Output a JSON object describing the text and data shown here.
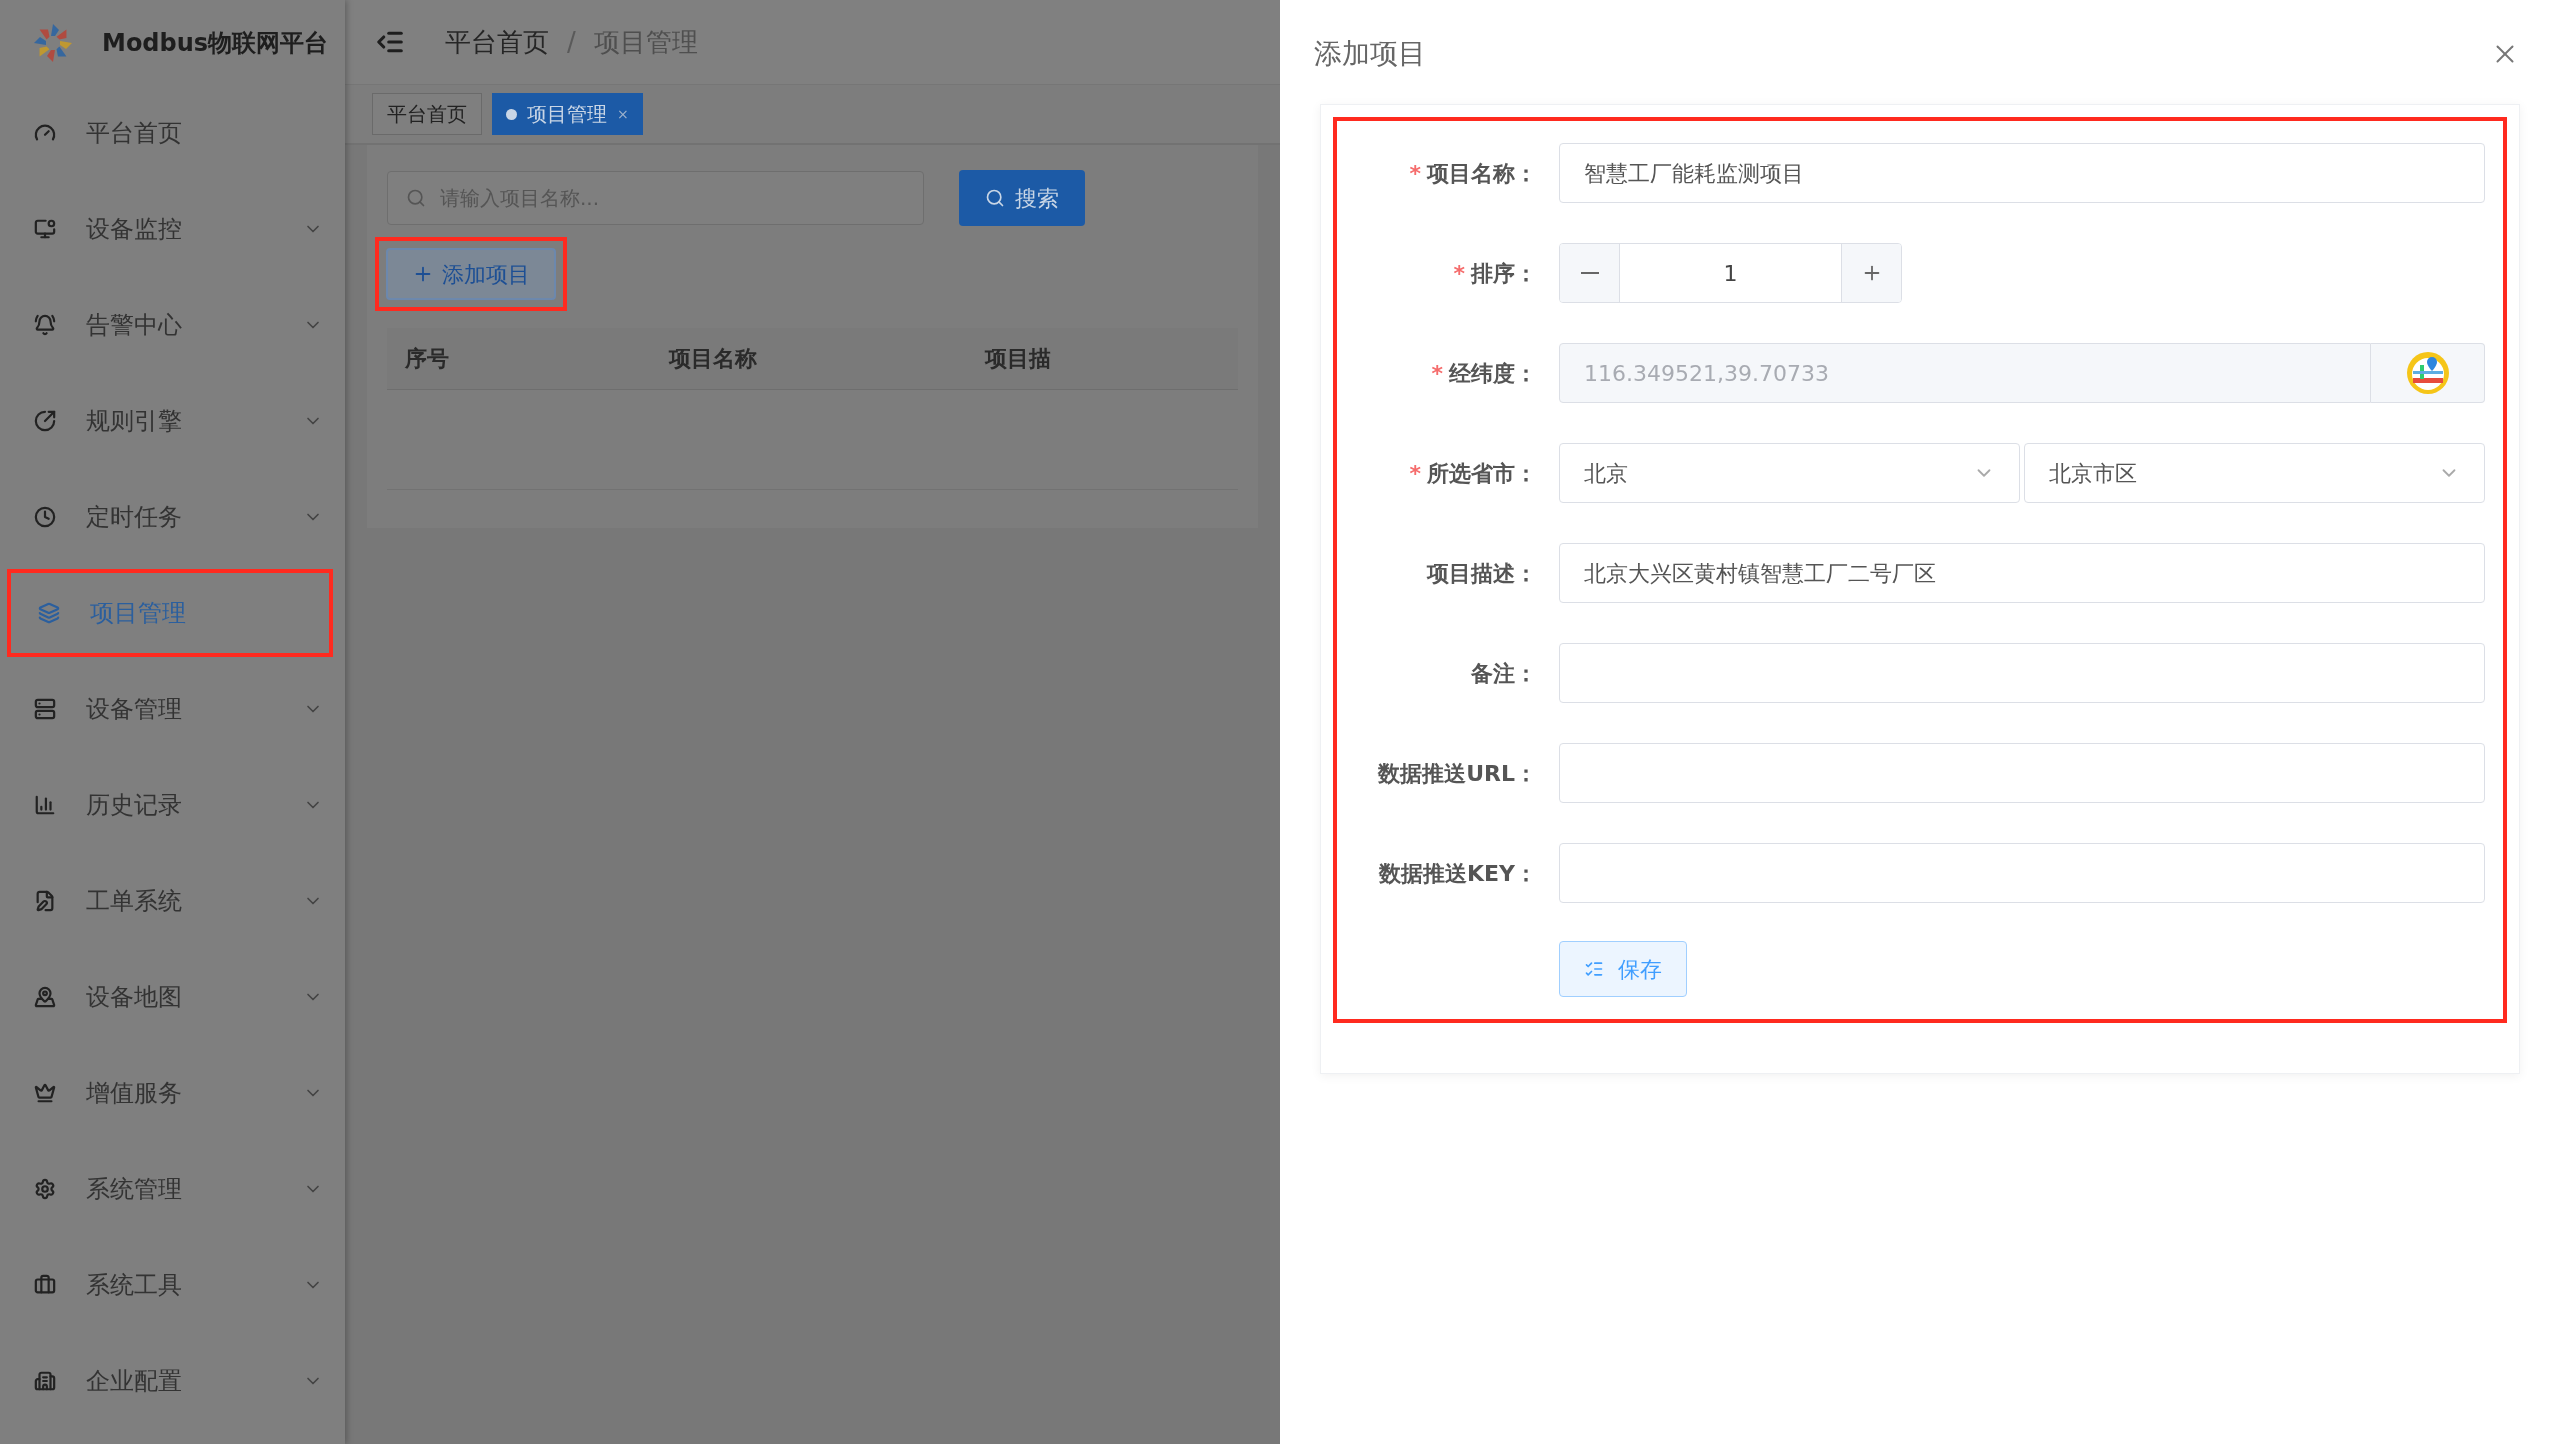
{
  "sidebar": {
    "logo_text": "Modbus物联网平台",
    "items": [
      {
        "label": "平台首页",
        "selected": false,
        "expandable": false,
        "highlighted": false
      },
      {
        "label": "设备监控",
        "selected": false,
        "expandable": true,
        "highlighted": false
      },
      {
        "label": "告警中心",
        "selected": false,
        "expandable": true,
        "highlighted": false
      },
      {
        "label": "规则引擎",
        "selected": false,
        "expandable": true,
        "highlighted": false
      },
      {
        "label": "定时任务",
        "selected": false,
        "expandable": true,
        "highlighted": false
      },
      {
        "label": "项目管理",
        "selected": true,
        "expandable": false,
        "highlighted": true
      },
      {
        "label": "设备管理",
        "selected": false,
        "expandable": true,
        "highlighted": false
      },
      {
        "label": "历史记录",
        "selected": false,
        "expandable": true,
        "highlighted": false
      },
      {
        "label": "工单系统",
        "selected": false,
        "expandable": true,
        "highlighted": false
      },
      {
        "label": "设备地图",
        "selected": false,
        "expandable": true,
        "highlighted": false
      },
      {
        "label": "增值服务",
        "selected": false,
        "expandable": true,
        "highlighted": false
      },
      {
        "label": "系统管理",
        "selected": false,
        "expandable": true,
        "highlighted": false
      },
      {
        "label": "系统工具",
        "selected": false,
        "expandable": true,
        "highlighted": false
      },
      {
        "label": "企业配置",
        "selected": false,
        "expandable": true,
        "highlighted": false
      }
    ]
  },
  "header": {
    "breadcrumb": [
      "平台首页",
      "项目管理"
    ],
    "breadcrumb_separator": "/"
  },
  "tabs": [
    {
      "label": "平台首页",
      "selected": false
    },
    {
      "label": "项目管理",
      "selected": true,
      "close_glyph": "×"
    }
  ],
  "search": {
    "placeholder": "请输入项目名称...",
    "button": "搜索"
  },
  "add_button": {
    "label": "添加项目",
    "highlighted": true
  },
  "table": {
    "columns": [
      "序号",
      "项目名称",
      "项目描"
    ]
  },
  "drawer": {
    "title": "添加项目",
    "required_mark": "*",
    "form_highlighted": true,
    "fields": [
      {
        "kind": "text",
        "label": "项目名称：",
        "required": true,
        "value": "智慧工厂能耗监测项目"
      },
      {
        "kind": "number",
        "label": "排序：",
        "required": true,
        "value": "1"
      },
      {
        "kind": "location",
        "label": "经纬度：",
        "required": true,
        "value": "116.349521,39.70733",
        "disabled": true
      },
      {
        "kind": "select_pair",
        "label": "所选省市：",
        "required": true,
        "values": [
          "北京",
          "北京市区"
        ]
      },
      {
        "kind": "text",
        "label": "项目描述：",
        "required": false,
        "value": "北京大兴区黄村镇智慧工厂二号厂区"
      },
      {
        "kind": "text",
        "label": "备注：",
        "required": false
      },
      {
        "kind": "text",
        "label": "数据推送URL：",
        "required": false
      },
      {
        "kind": "text",
        "label": "数据推送KEY：",
        "required": false
      }
    ],
    "save_button": "保存"
  }
}
